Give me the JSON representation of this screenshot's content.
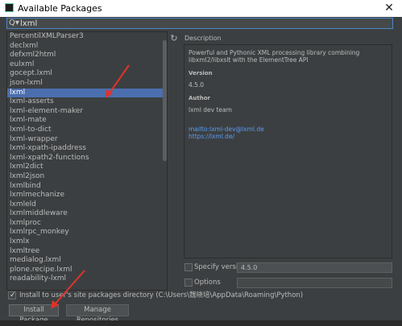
{
  "window": {
    "title": "Available Packages",
    "close_label": "✕"
  },
  "search": {
    "value": "lxml"
  },
  "packages": [
    "PercentilXMLParser3",
    "declxml",
    "defxml2html",
    "eulxml",
    "gocept.lxml",
    "json-lxml",
    "lxml",
    "lxml-asserts",
    "lxml-element-maker",
    "lxml-mate",
    "lxml-to-dict",
    "lxml-wrapper",
    "lxml-xpath-ipaddress",
    "lxml-xpath2-functions",
    "lxml2dict",
    "lxml2json",
    "lxmlbind",
    "lxmlmechanize",
    "lxmleld",
    "lxmlmiddleware",
    "lxmlproc",
    "lxmlrpc_monkey",
    "lxmlx",
    "lxmltree",
    "medialog.lxml",
    "plone.recipe.lxml",
    "readability-lxml"
  ],
  "selected_index": 6,
  "description": {
    "label": "Description",
    "summary": "Powerful and Pythonic XML processing library combining libxml2/libxslt with the ElementTree API",
    "version_head": "Version",
    "version_value": "4.5.0",
    "author_head": "Author",
    "author_value": "lxml dev team",
    "link_mail": "mailto:lxml-dev@lxml.de",
    "link_site": "https://lxml.de/"
  },
  "options": {
    "specify_version_label": "Specify version",
    "specify_version_value": "4.5.0",
    "options_label": "Options",
    "install_user_label": "Install to user's site packages directory (C:\\Users\\魏晓培\\AppData\\Roaming\\Python)"
  },
  "buttons": {
    "install": "Install Package",
    "manage": "Manage Repositories"
  },
  "colors": {
    "accent_selection": "#4b6eaf",
    "link": "#589df6",
    "annotation": "#e0332a"
  }
}
